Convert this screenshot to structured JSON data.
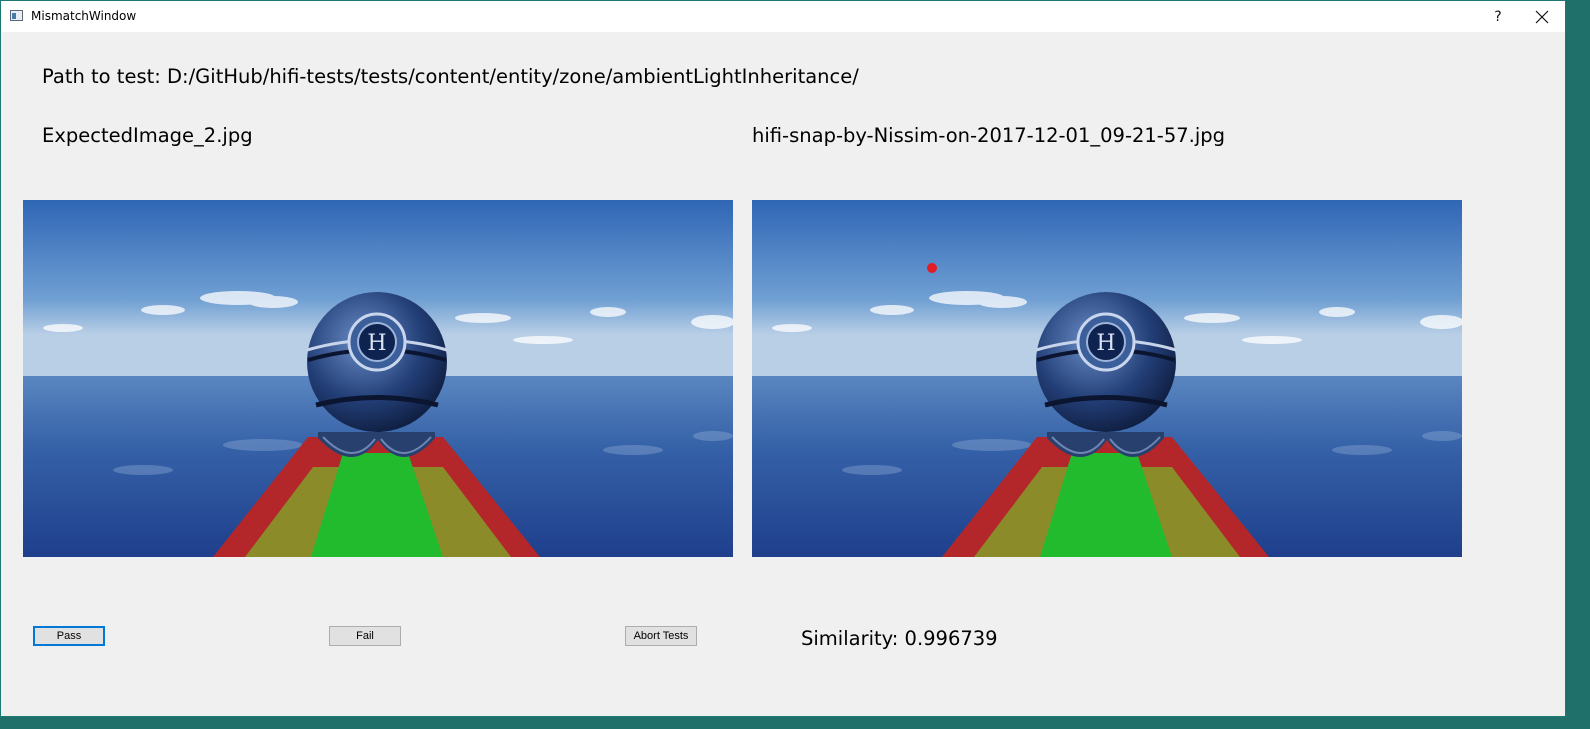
{
  "window": {
    "title": "MismatchWindow",
    "help_label": "?"
  },
  "path": {
    "label": "Path to test: D:/GitHub/hifi-tests/tests/content/entity/zone/ambientLightInheritance/"
  },
  "images": {
    "expected_name": "ExpectedImage_2.jpg",
    "actual_name": "hifi-snap-by-Nissim-on-2017-12-01_09-21-57.jpg"
  },
  "buttons": {
    "pass": "Pass",
    "fail": "Fail",
    "abort": "Abort Tests"
  },
  "similarity": {
    "label": "Similarity: 0.996739"
  },
  "colors": {
    "window_bg": "#f0f0f0",
    "focus_border": "#0078d7",
    "mismatch_marker": "#e21d25"
  }
}
